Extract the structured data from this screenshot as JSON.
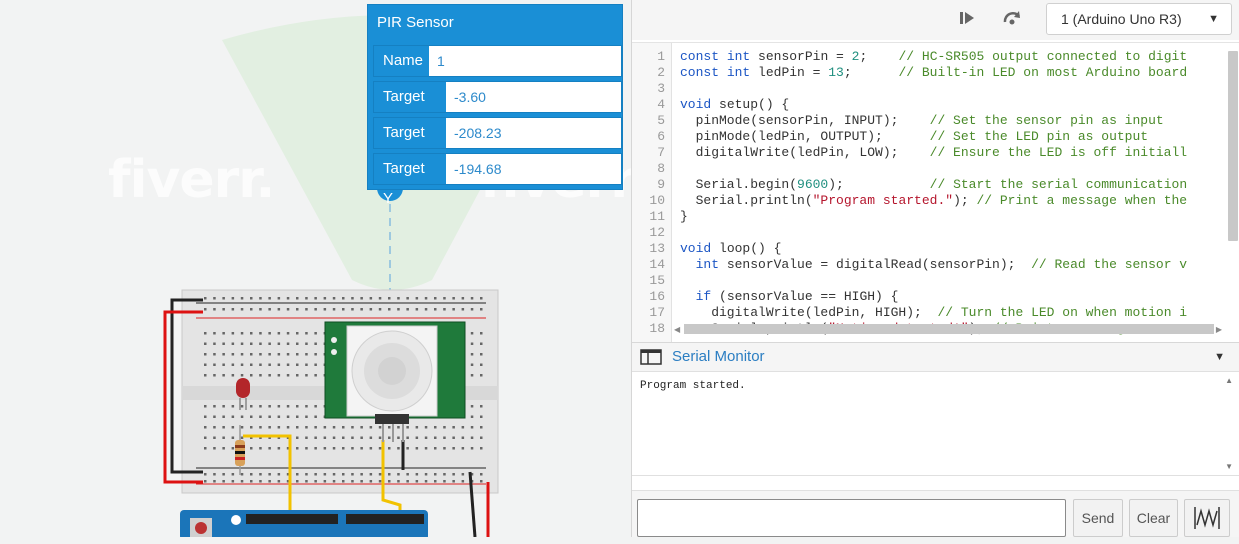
{
  "pir_panel": {
    "title": "PIR Sensor",
    "rows": [
      {
        "label": "Name",
        "value": "1"
      },
      {
        "label": "Target X",
        "value": "-3.60"
      },
      {
        "label": "Target Y",
        "value": "-208.23"
      },
      {
        "label": "Target Y",
        "value": "-194.68"
      }
    ]
  },
  "canvas": {
    "watermarks": [
      "fiverr.",
      "fiverr.",
      "fiverr."
    ]
  },
  "toolbar": {
    "upload_icon": "step-forward-icon",
    "restart_icon": "restart-icon",
    "board_select": "1 (Arduino Uno R3)"
  },
  "editor": {
    "lines": [
      {
        "n": "1",
        "t": "const int sensorPin = 2;    // HC-SR505 output connected to digit"
      },
      {
        "n": "2",
        "t": "const int ledPin = 13;      // Built-in LED on most Arduino board"
      },
      {
        "n": "3",
        "t": ""
      },
      {
        "n": "4",
        "t": "void setup() {"
      },
      {
        "n": "5",
        "t": "  pinMode(sensorPin, INPUT);    // Set the sensor pin as input"
      },
      {
        "n": "6",
        "t": "  pinMode(ledPin, OUTPUT);      // Set the LED pin as output"
      },
      {
        "n": "7",
        "t": "  digitalWrite(ledPin, LOW);    // Ensure the LED is off initiall"
      },
      {
        "n": "8",
        "t": ""
      },
      {
        "n": "9",
        "t": "  Serial.begin(9600);           // Start the serial communication"
      },
      {
        "n": "10",
        "t": "  Serial.println(\"Program started.\"); // Print a message when the"
      },
      {
        "n": "11",
        "t": "}"
      },
      {
        "n": "12",
        "t": ""
      },
      {
        "n": "13",
        "t": "void loop() {"
      },
      {
        "n": "14",
        "t": "  int sensorValue = digitalRead(sensorPin);  // Read the sensor v"
      },
      {
        "n": "15",
        "t": ""
      },
      {
        "n": "16",
        "t": "  if (sensorValue == HIGH) {"
      },
      {
        "n": "17",
        "t": "    digitalWrite(ledPin, HIGH);  // Turn the LED on when motion i"
      },
      {
        "n": "18",
        "t": "    Serial.println(\"Motion detected!\"); // Print a message"
      }
    ]
  },
  "serial": {
    "title": "Serial Monitor",
    "output": "Program started.",
    "input_value": "",
    "send_label": "Send",
    "clear_label": "Clear",
    "graph_icon": "waveform-graph-icon"
  }
}
